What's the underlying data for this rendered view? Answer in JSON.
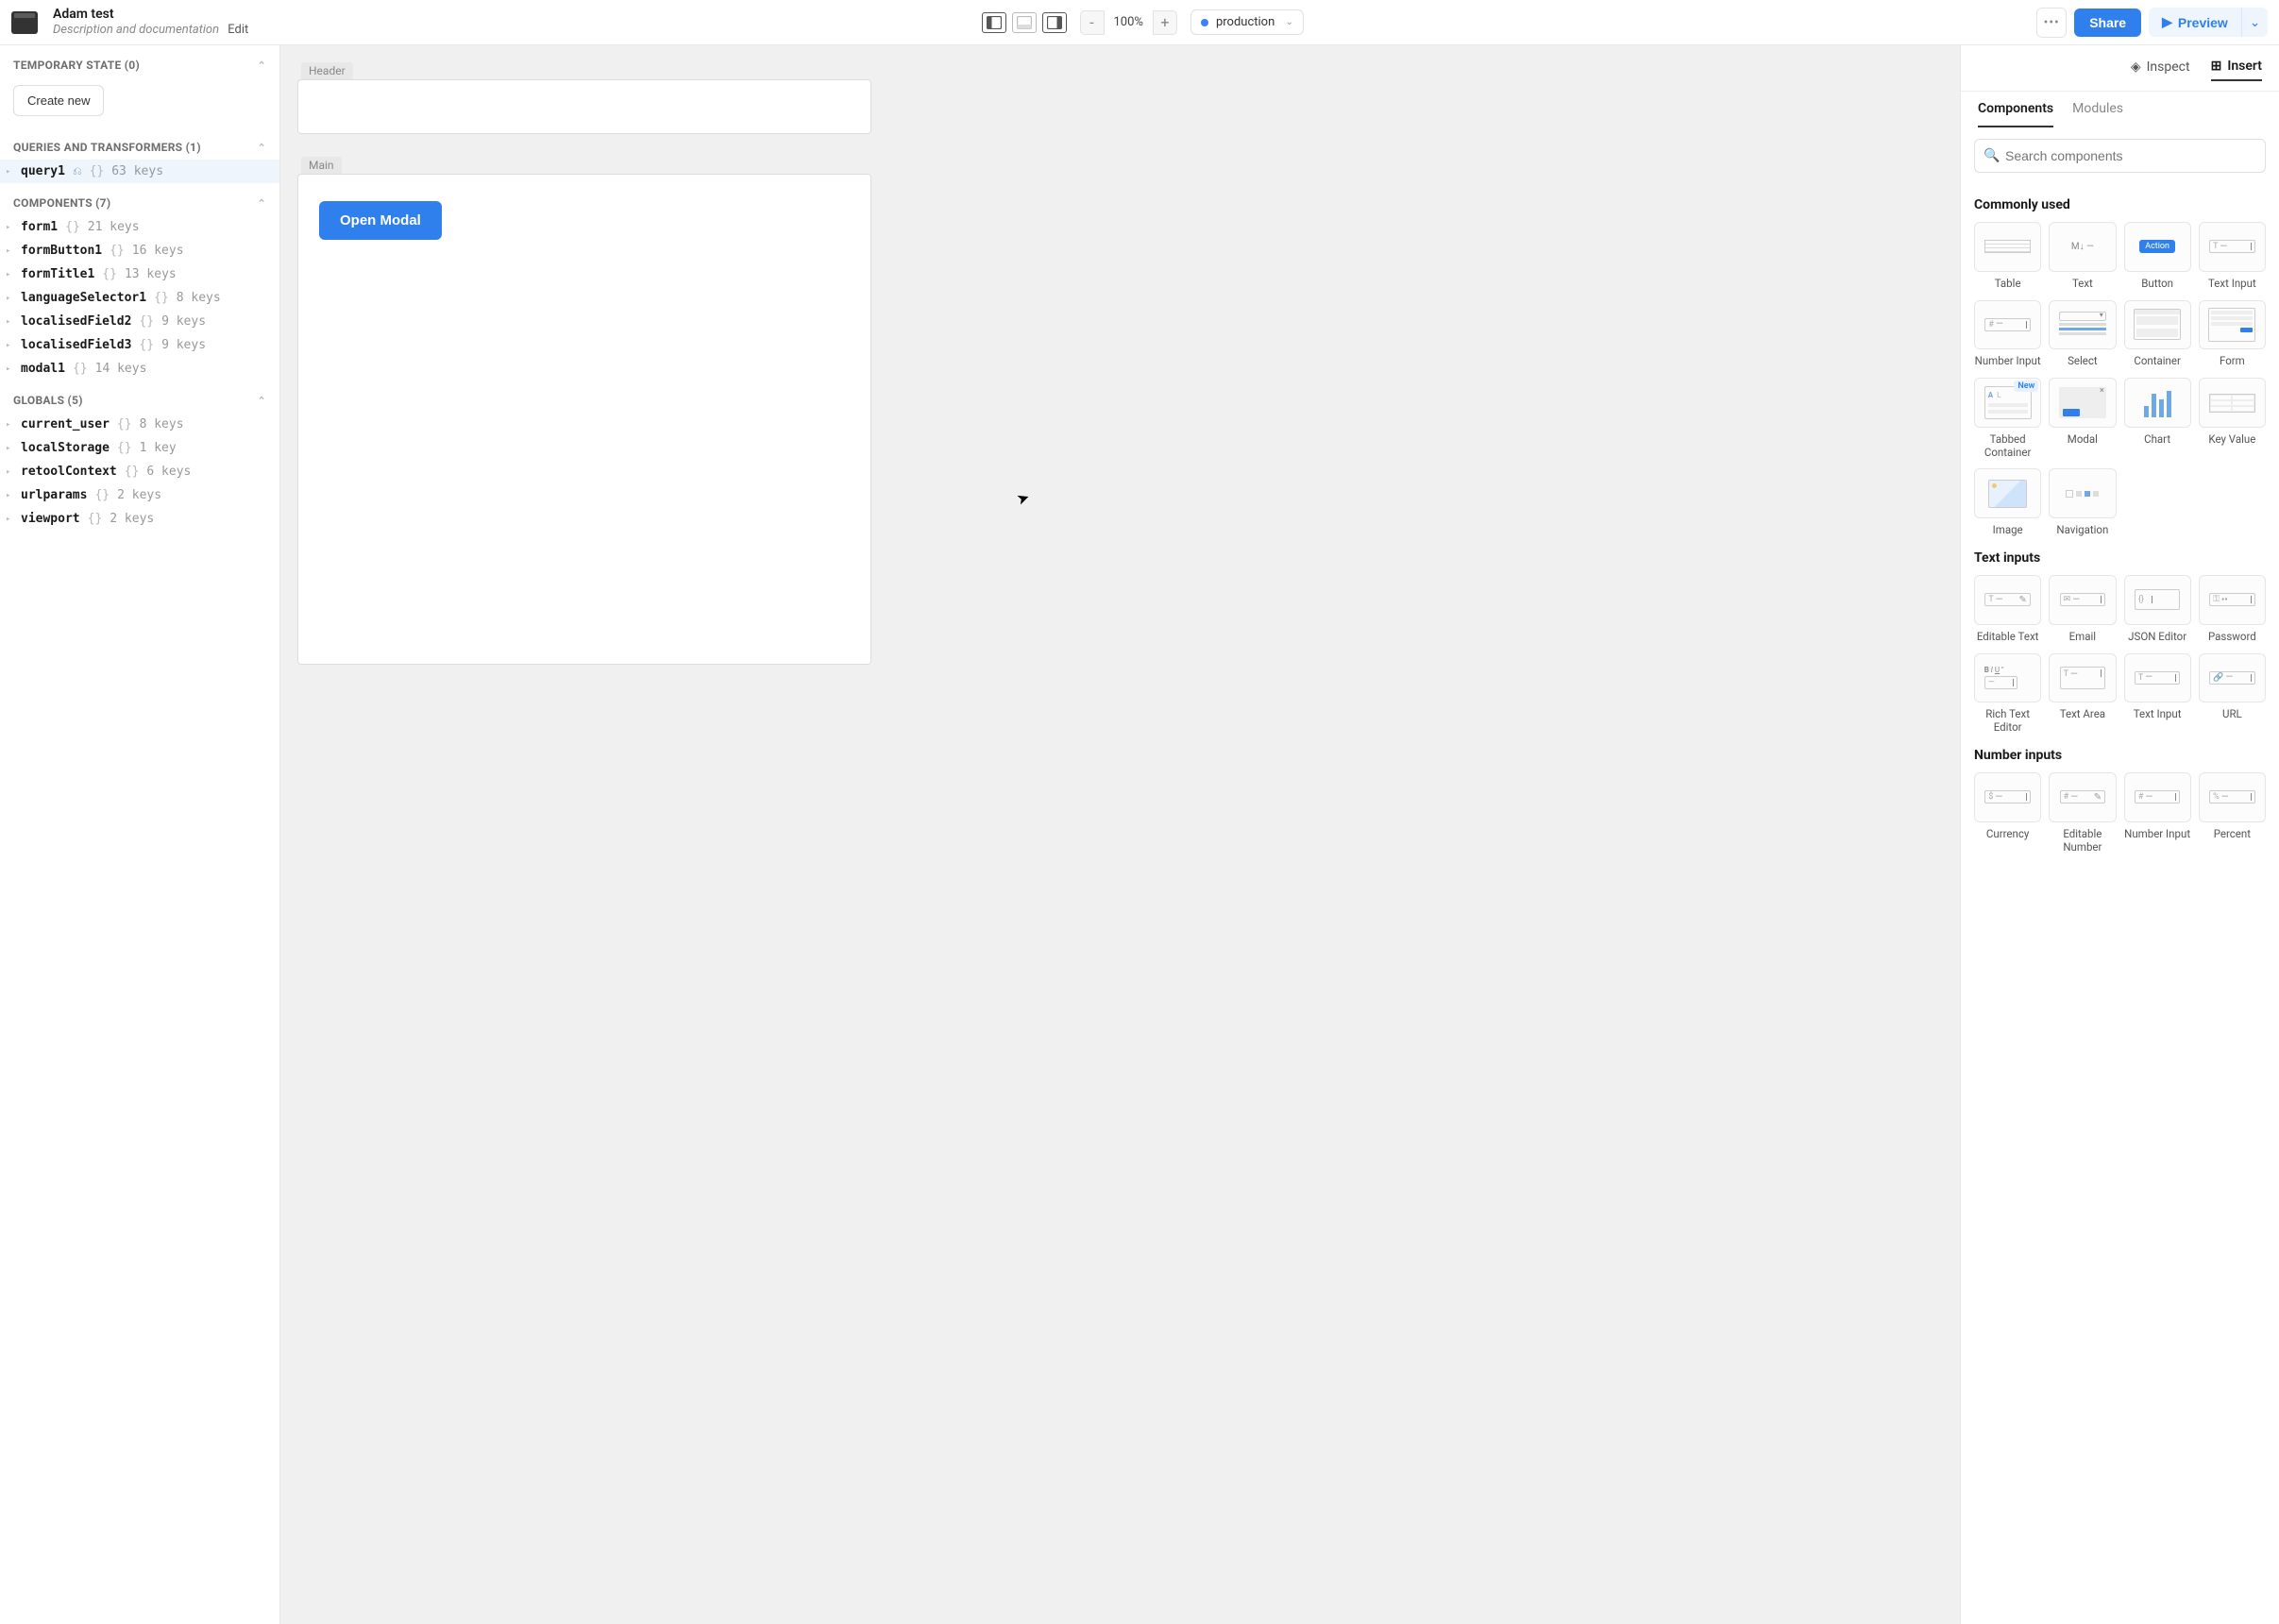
{
  "topbar": {
    "title": "Adam test",
    "subtitle": "Description and documentation",
    "edit": "Edit",
    "zoom": {
      "minus": "-",
      "value": "100%",
      "plus": "+"
    },
    "env": {
      "label": "production"
    },
    "more": "•••",
    "share": "Share",
    "preview": "Preview"
  },
  "left": {
    "sections": {
      "temp_state": {
        "title": "TEMPORARY STATE (0)",
        "create": "Create new"
      },
      "queries": {
        "title": "QUERIES AND TRANSFORMERS (1)",
        "items": [
          {
            "name": "query1",
            "keys": "63 keys",
            "selected": true,
            "hasIcon": true
          }
        ]
      },
      "components": {
        "title": "COMPONENTS (7)",
        "items": [
          {
            "name": "form1",
            "keys": "21 keys"
          },
          {
            "name": "formButton1",
            "keys": "16 keys"
          },
          {
            "name": "formTitle1",
            "keys": "13 keys"
          },
          {
            "name": "languageSelector1",
            "keys": "8 keys"
          },
          {
            "name": "localisedField2",
            "keys": "9 keys"
          },
          {
            "name": "localisedField3",
            "keys": "9 keys"
          },
          {
            "name": "modal1",
            "keys": "14 keys"
          }
        ]
      },
      "globals": {
        "title": "GLOBALS (5)",
        "items": [
          {
            "name": "current_user",
            "keys": "8 keys"
          },
          {
            "name": "localStorage",
            "keys": "1 key"
          },
          {
            "name": "retoolContext",
            "keys": "6 keys"
          },
          {
            "name": "urlparams",
            "keys": "2 keys"
          },
          {
            "name": "viewport",
            "keys": "2 keys"
          }
        ]
      }
    }
  },
  "canvas": {
    "header_label": "Header",
    "main_label": "Main",
    "open_modal": "Open Modal"
  },
  "right": {
    "top_tabs": {
      "inspect": "Inspect",
      "insert": "Insert"
    },
    "sub_tabs": {
      "components": "Components",
      "modules": "Modules"
    },
    "search_placeholder": "Search components",
    "groups": [
      {
        "title": "Commonly used",
        "items": [
          {
            "label": "Table",
            "thumb": "table"
          },
          {
            "label": "Text",
            "thumb": "text"
          },
          {
            "label": "Button",
            "thumb": "button",
            "btn_text": "Action"
          },
          {
            "label": "Text Input",
            "thumb": "textinput"
          },
          {
            "label": "Number Input",
            "thumb": "numberinput"
          },
          {
            "label": "Select",
            "thumb": "select"
          },
          {
            "label": "Container",
            "thumb": "container"
          },
          {
            "label": "Form",
            "thumb": "form"
          },
          {
            "label": "Tabbed Container",
            "thumb": "tabbed",
            "badge": "New"
          },
          {
            "label": "Modal",
            "thumb": "modal"
          },
          {
            "label": "Chart",
            "thumb": "chart"
          },
          {
            "label": "Key Value",
            "thumb": "kv"
          },
          {
            "label": "Image",
            "thumb": "image"
          },
          {
            "label": "Navigation",
            "thumb": "nav"
          }
        ]
      },
      {
        "title": "Text inputs",
        "items": [
          {
            "label": "Editable Text",
            "thumb": "editabletext"
          },
          {
            "label": "Email",
            "thumb": "email"
          },
          {
            "label": "JSON Editor",
            "thumb": "json"
          },
          {
            "label": "Password",
            "thumb": "password"
          },
          {
            "label": "Rich Text Editor",
            "thumb": "rte"
          },
          {
            "label": "Text Area",
            "thumb": "textarea"
          },
          {
            "label": "Text Input",
            "thumb": "textinput"
          },
          {
            "label": "URL",
            "thumb": "url"
          }
        ]
      },
      {
        "title": "Number inputs",
        "items": [
          {
            "label": "Currency",
            "thumb": "currency"
          },
          {
            "label": "Editable Number",
            "thumb": "editnum"
          },
          {
            "label": "Number Input",
            "thumb": "numberinput"
          },
          {
            "label": "Percent",
            "thumb": "percent"
          }
        ]
      }
    ]
  }
}
